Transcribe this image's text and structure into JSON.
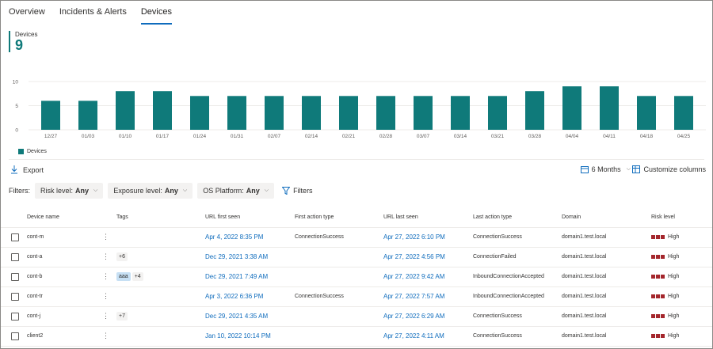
{
  "tabs": [
    {
      "label": "Overview"
    },
    {
      "label": "Incidents & Alerts"
    },
    {
      "label": "Devices"
    }
  ],
  "kpi": {
    "label": "Devices",
    "value": "9"
  },
  "chart_data": {
    "type": "bar",
    "categories": [
      "12/27",
      "01/03",
      "01/10",
      "01/17",
      "01/24",
      "01/31",
      "02/07",
      "02/14",
      "02/21",
      "02/28",
      "03/07",
      "03/14",
      "03/21",
      "03/28",
      "04/04",
      "04/11",
      "04/18",
      "04/25"
    ],
    "series": [
      {
        "name": "Devices",
        "values": [
          6,
          6,
          8,
          8,
          7,
          7,
          7,
          7,
          7,
          7,
          7,
          7,
          7,
          8,
          9,
          9,
          7,
          7
        ]
      }
    ],
    "ylim": [
      0,
      10
    ],
    "yticks": [
      "0",
      "5",
      "10"
    ],
    "grid": true,
    "legend_position": "bottom-left",
    "color": "#0f7a7a"
  },
  "toolbar": {
    "export_label": "Export",
    "range_label": "6 Months",
    "customize_label": "Customize columns"
  },
  "filters": {
    "label": "Filters:",
    "chips": [
      {
        "name": "Risk level:",
        "value": "Any"
      },
      {
        "name": "Exposure level:",
        "value": "Any"
      },
      {
        "name": "OS Platform:",
        "value": "Any"
      }
    ],
    "button_label": "Filters"
  },
  "table": {
    "headers": [
      "Device name",
      "Tags",
      "URL first seen",
      "First action type",
      "URL last seen",
      "Last action type",
      "Domain",
      "Risk level"
    ],
    "rows": [
      {
        "name": "cont-m",
        "tags": [],
        "url_first": "Apr 4, 2022 8:35 PM",
        "first_action": "ConnectionSuccess",
        "url_last": "Apr 27, 2022 6:10 PM",
        "last_action": "ConnectionSuccess",
        "domain": "domain1.test.local",
        "risk": "High"
      },
      {
        "name": "cont-a",
        "tags": [
          "+6"
        ],
        "url_first": "Dec 29, 2021 3:38 AM",
        "first_action": "",
        "url_last": "Apr 27, 2022 4:56 PM",
        "last_action": "ConnectionFailed",
        "domain": "domain1.test.local",
        "risk": "High"
      },
      {
        "name": "cont-b",
        "tags": [
          "aaa",
          "+4"
        ],
        "url_first": "Dec 29, 2021 7:49 AM",
        "first_action": "",
        "url_last": "Apr 27, 2022 9:42 AM",
        "last_action": "InboundConnectionAccepted",
        "domain": "domain1.test.local",
        "risk": "High"
      },
      {
        "name": "cont-tr",
        "tags": [],
        "url_first": "Apr 3, 2022 6:36 PM",
        "first_action": "ConnectionSuccess",
        "url_last": "Apr 27, 2022 7:57 AM",
        "last_action": "InboundConnectionAccepted",
        "domain": "domain1.test.local",
        "risk": "High"
      },
      {
        "name": "cont-j",
        "tags": [
          "+7"
        ],
        "url_first": "Dec 29, 2021 4:35 AM",
        "first_action": "",
        "url_last": "Apr 27, 2022 6:29 AM",
        "last_action": "ConnectionSuccess",
        "domain": "domain1.test.local",
        "risk": "High"
      },
      {
        "name": "client2",
        "tags": [],
        "url_first": "Jan 10, 2022 10:14 PM",
        "first_action": "",
        "url_last": "Apr 27, 2022 4:11 AM",
        "last_action": "ConnectionSuccess",
        "domain": "domain1.test.local",
        "risk": "High"
      }
    ]
  }
}
